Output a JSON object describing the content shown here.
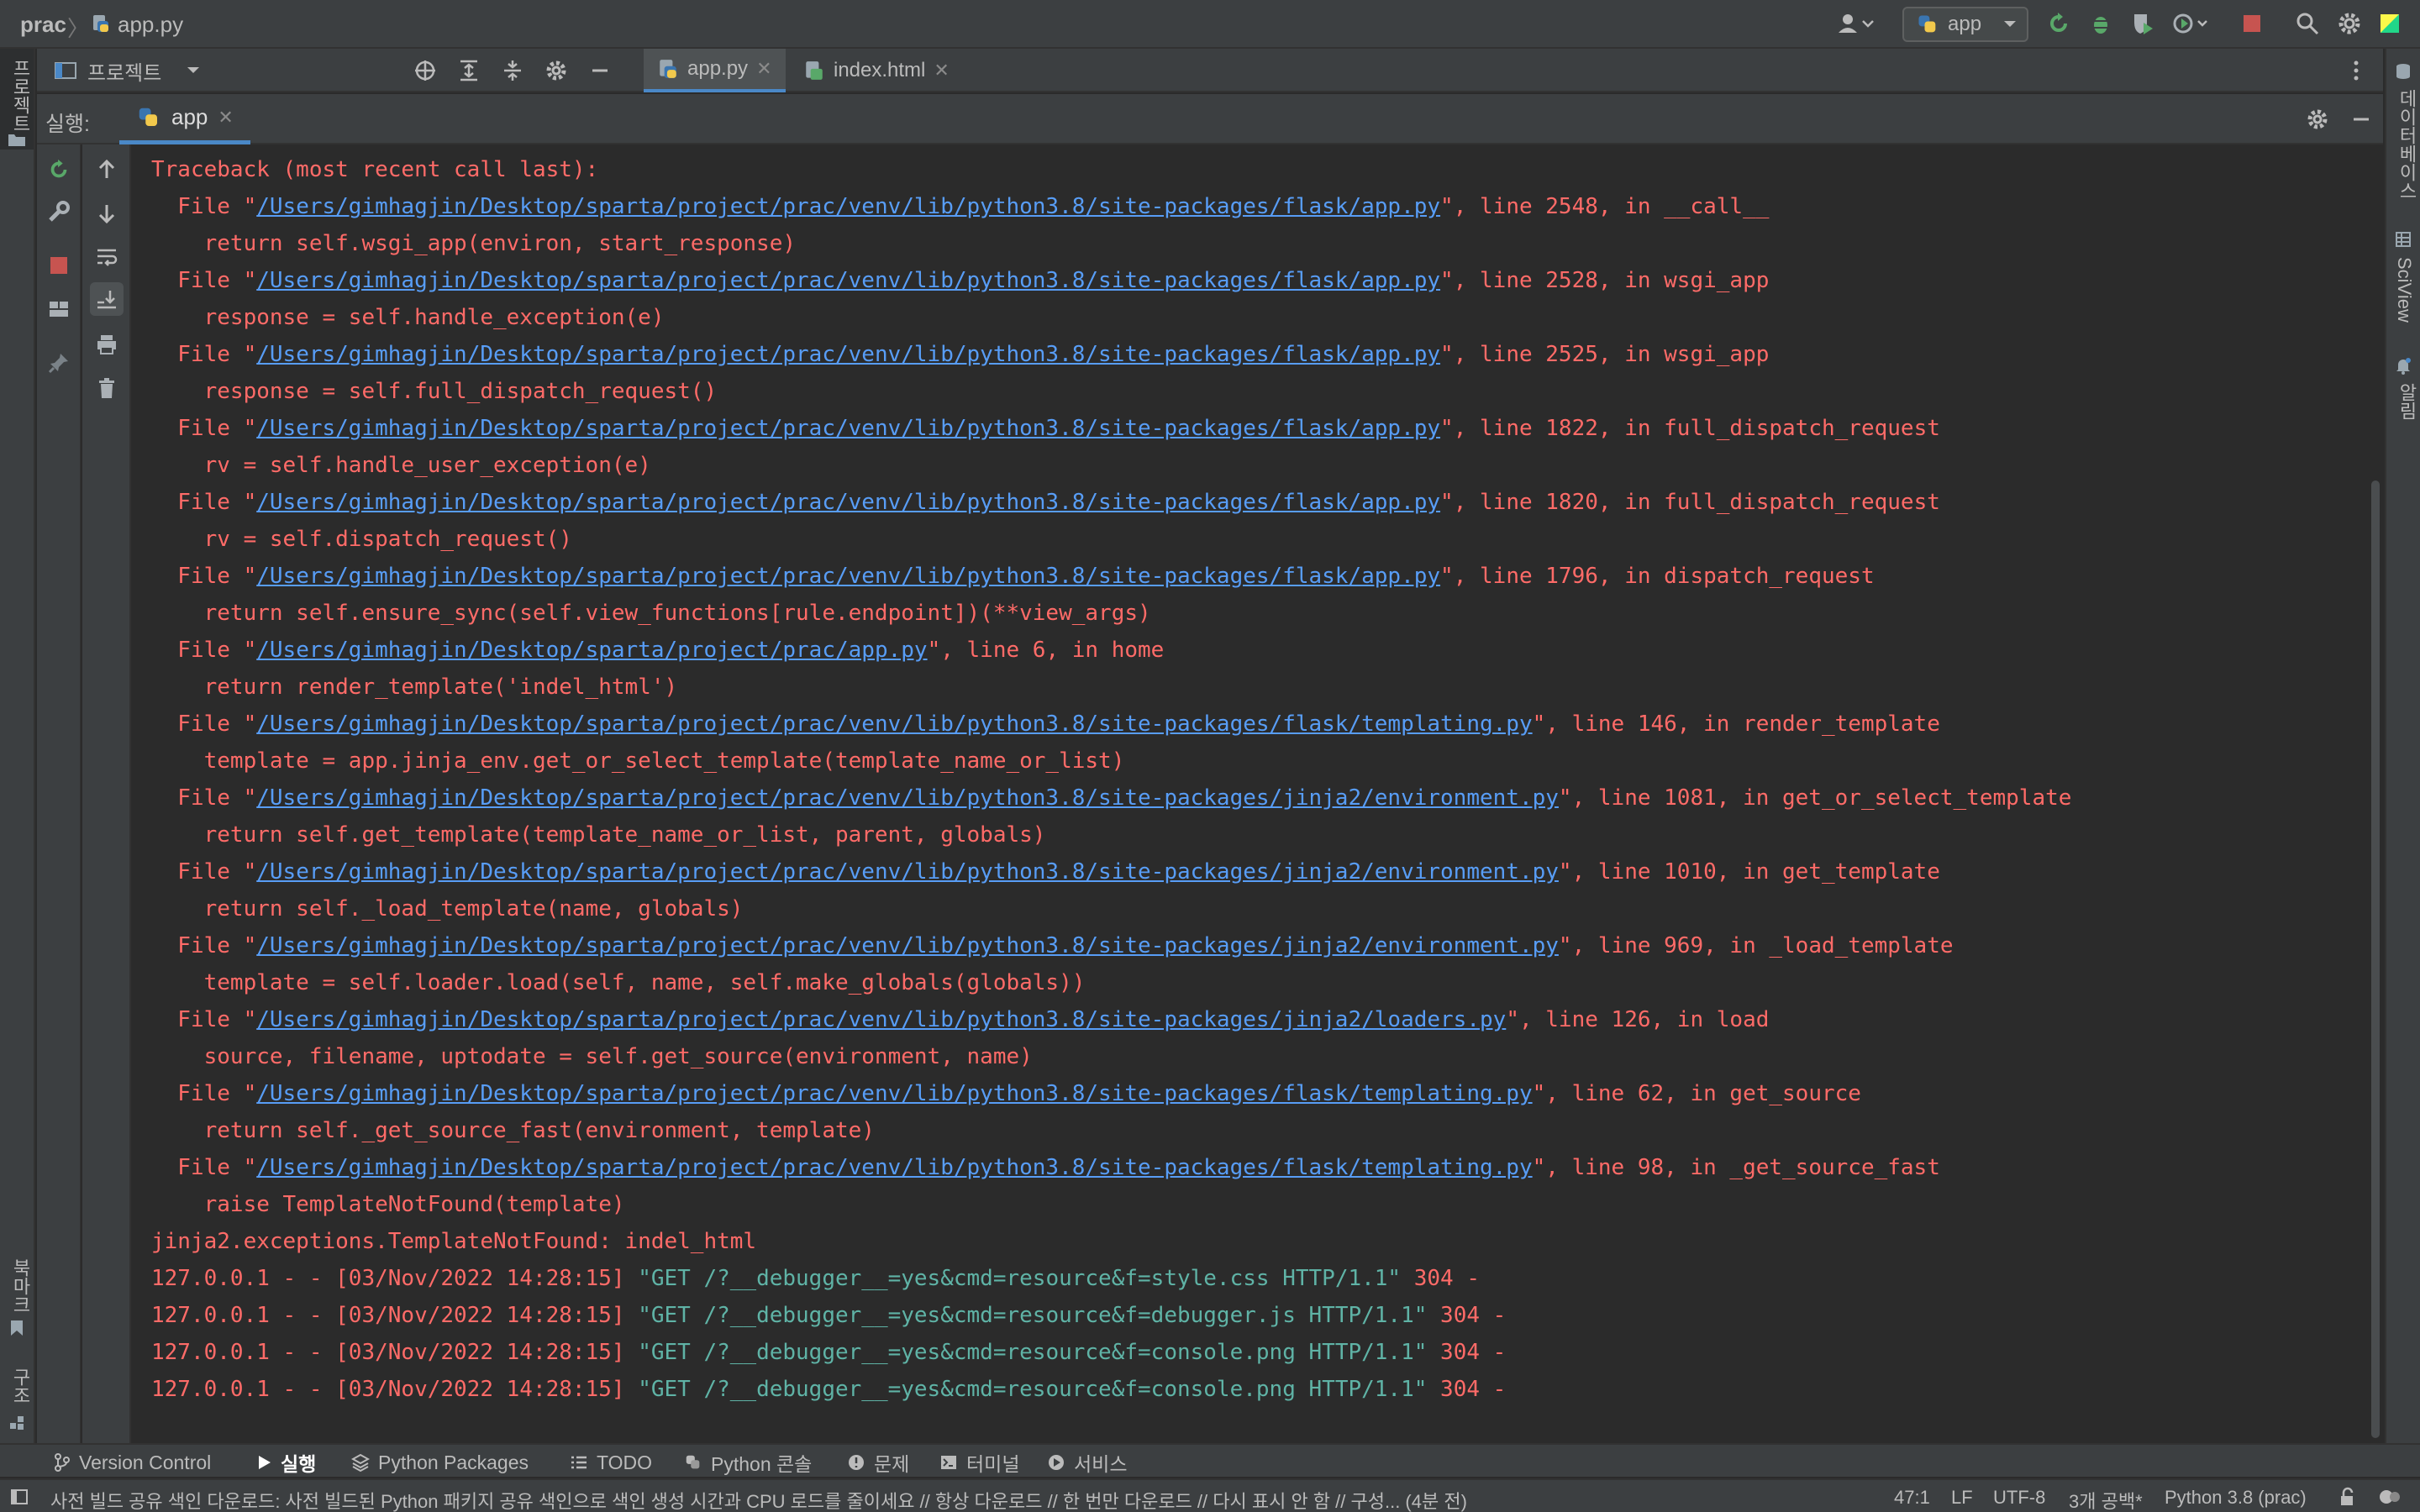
{
  "titlebar": {
    "project": "prac",
    "file": "app.py",
    "run_config": "app"
  },
  "toolbar": {
    "project_label": "프로젝트",
    "tabs": [
      {
        "label": "app.py",
        "active": true
      },
      {
        "label": "index.html",
        "active": false
      }
    ]
  },
  "run": {
    "label": "실행:",
    "tab": "app"
  },
  "left_strip": {
    "top_label": "프로젝트",
    "bookmarks_label": "북마크",
    "structure_label": "구조"
  },
  "right_strip": {
    "database_label": "데이터베이스",
    "sciview_label": "SciView",
    "notifications_label": "알림"
  },
  "console": {
    "lines": [
      {
        "kind": "plain",
        "text": "Traceback (most recent call last):"
      },
      {
        "kind": "file",
        "prefix": "  File \"",
        "path": "/Users/gimhagjin/Desktop/sparta/project/prac/venv/lib/python3.8/site-packages/flask/app.py",
        "suffix": "\", line 2548, in __call__"
      },
      {
        "kind": "plain",
        "text": "    return self.wsgi_app(environ, start_response)"
      },
      {
        "kind": "file",
        "prefix": "  File \"",
        "path": "/Users/gimhagjin/Desktop/sparta/project/prac/venv/lib/python3.8/site-packages/flask/app.py",
        "suffix": "\", line 2528, in wsgi_app"
      },
      {
        "kind": "plain",
        "text": "    response = self.handle_exception(e)"
      },
      {
        "kind": "file",
        "prefix": "  File \"",
        "path": "/Users/gimhagjin/Desktop/sparta/project/prac/venv/lib/python3.8/site-packages/flask/app.py",
        "suffix": "\", line 2525, in wsgi_app"
      },
      {
        "kind": "plain",
        "text": "    response = self.full_dispatch_request()"
      },
      {
        "kind": "file",
        "prefix": "  File \"",
        "path": "/Users/gimhagjin/Desktop/sparta/project/prac/venv/lib/python3.8/site-packages/flask/app.py",
        "suffix": "\", line 1822, in full_dispatch_request"
      },
      {
        "kind": "plain",
        "text": "    rv = self.handle_user_exception(e)"
      },
      {
        "kind": "file",
        "prefix": "  File \"",
        "path": "/Users/gimhagjin/Desktop/sparta/project/prac/venv/lib/python3.8/site-packages/flask/app.py",
        "suffix": "\", line 1820, in full_dispatch_request"
      },
      {
        "kind": "plain",
        "text": "    rv = self.dispatch_request()"
      },
      {
        "kind": "file",
        "prefix": "  File \"",
        "path": "/Users/gimhagjin/Desktop/sparta/project/prac/venv/lib/python3.8/site-packages/flask/app.py",
        "suffix": "\", line 1796, in dispatch_request"
      },
      {
        "kind": "plain",
        "text": "    return self.ensure_sync(self.view_functions[rule.endpoint])(**view_args)"
      },
      {
        "kind": "file",
        "prefix": "  File \"",
        "path": "/Users/gimhagjin/Desktop/sparta/project/prac/app.py",
        "suffix": "\", line 6, in home"
      },
      {
        "kind": "plain",
        "text": "    return render_template('indel_html')"
      },
      {
        "kind": "file",
        "prefix": "  File \"",
        "path": "/Users/gimhagjin/Desktop/sparta/project/prac/venv/lib/python3.8/site-packages/flask/templating.py",
        "suffix": "\", line 146, in render_template"
      },
      {
        "kind": "plain",
        "text": "    template = app.jinja_env.get_or_select_template(template_name_or_list)"
      },
      {
        "kind": "file",
        "prefix": "  File \"",
        "path": "/Users/gimhagjin/Desktop/sparta/project/prac/venv/lib/python3.8/site-packages/jinja2/environment.py",
        "suffix": "\", line 1081, in get_or_select_template"
      },
      {
        "kind": "plain",
        "text": "    return self.get_template(template_name_or_list, parent, globals)"
      },
      {
        "kind": "file",
        "prefix": "  File \"",
        "path": "/Users/gimhagjin/Desktop/sparta/project/prac/venv/lib/python3.8/site-packages/jinja2/environment.py",
        "suffix": "\", line 1010, in get_template"
      },
      {
        "kind": "plain",
        "text": "    return self._load_template(name, globals)"
      },
      {
        "kind": "file",
        "prefix": "  File \"",
        "path": "/Users/gimhagjin/Desktop/sparta/project/prac/venv/lib/python3.8/site-packages/jinja2/environment.py",
        "suffix": "\", line 969, in _load_template"
      },
      {
        "kind": "plain",
        "text": "    template = self.loader.load(self, name, self.make_globals(globals))"
      },
      {
        "kind": "file",
        "prefix": "  File \"",
        "path": "/Users/gimhagjin/Desktop/sparta/project/prac/venv/lib/python3.8/site-packages/jinja2/loaders.py",
        "suffix": "\", line 126, in load"
      },
      {
        "kind": "plain",
        "text": "    source, filename, uptodate = self.get_source(environment, name)"
      },
      {
        "kind": "file",
        "prefix": "  File \"",
        "path": "/Users/gimhagjin/Desktop/sparta/project/prac/venv/lib/python3.8/site-packages/flask/templating.py",
        "suffix": "\", line 62, in get_source"
      },
      {
        "kind": "plain",
        "text": "    return self._get_source_fast(environment, template)"
      },
      {
        "kind": "file",
        "prefix": "  File \"",
        "path": "/Users/gimhagjin/Desktop/sparta/project/prac/venv/lib/python3.8/site-packages/flask/templating.py",
        "suffix": "\", line 98, in _get_source_fast"
      },
      {
        "kind": "plain",
        "text": "    raise TemplateNotFound(template)"
      },
      {
        "kind": "plain",
        "text": "jinja2.exceptions.TemplateNotFound: indel_html"
      },
      {
        "kind": "log",
        "prefix": "127.0.0.1 - - [03/Nov/2022 14:28:15] ",
        "request": "\"GET /?__debugger__=yes&cmd=resource&f=style.css HTTP/1.1\"",
        "suffix": " 304 -"
      },
      {
        "kind": "log",
        "prefix": "127.0.0.1 - - [03/Nov/2022 14:28:15] ",
        "request": "\"GET /?__debugger__=yes&cmd=resource&f=debugger.js HTTP/1.1\"",
        "suffix": " 304 -"
      },
      {
        "kind": "log",
        "prefix": "127.0.0.1 - - [03/Nov/2022 14:28:15] ",
        "request": "\"GET /?__debugger__=yes&cmd=resource&f=console.png HTTP/1.1\"",
        "suffix": " 304 -"
      },
      {
        "kind": "log",
        "prefix": "127.0.0.1 - - [03/Nov/2022 14:28:15] ",
        "request": "\"GET /?__debugger__=yes&cmd=resource&f=console.png HTTP/1.1\"",
        "suffix": " 304 -"
      }
    ]
  },
  "bottom_tabs": [
    {
      "label": "Version Control",
      "icon": "branch-icon",
      "active": false
    },
    {
      "label": "실행",
      "icon": "run-icon",
      "active": true
    },
    {
      "label": "Python Packages",
      "icon": "packages-icon",
      "active": false
    },
    {
      "label": "TODO",
      "icon": "list-icon",
      "active": false
    },
    {
      "label": "Python 콘솔",
      "icon": "python-icon",
      "active": false
    },
    {
      "label": "문제",
      "icon": "problems-icon",
      "active": false
    },
    {
      "label": "터미널",
      "icon": "terminal-icon",
      "active": false
    },
    {
      "label": "서비스",
      "icon": "services-icon",
      "active": false
    }
  ],
  "status": {
    "message": "사전 빌드 공유 색인 다운로드: 사전 빌드된 Python 패키지 공유 색인으로 색인 생성 시간과 CPU 로드를 줄이세요 // 항상 다운로드 // 한 번만 다운로드 // 다시 표시 안 함 // 구성... (4분 전)",
    "position": "47:1",
    "line_sep": "LF",
    "encoding": "UTF-8",
    "indent": "3개 공백*",
    "interpreter": "Python 3.8 (prac)"
  },
  "colors": {
    "error": "#ff6b68",
    "link": "#589df6",
    "log_request": "#5fb3a6",
    "accent": "#4a88c7",
    "run_green": "#59a869",
    "stop_red": "#c75450"
  }
}
